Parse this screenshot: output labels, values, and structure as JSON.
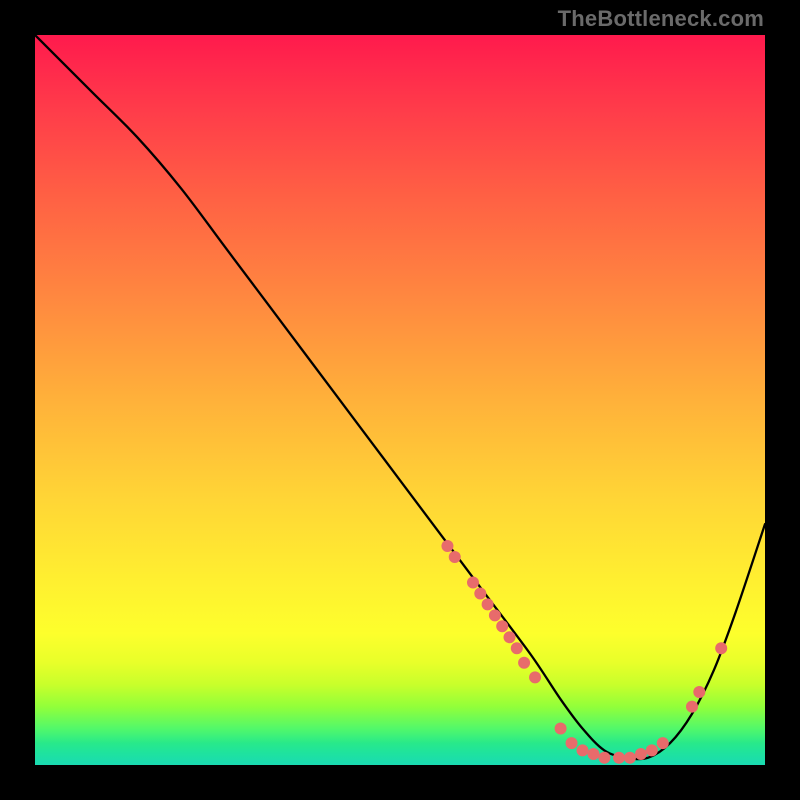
{
  "watermark": "TheBottleneck.com",
  "chart_data": {
    "type": "line",
    "title": "",
    "xlabel": "",
    "ylabel": "",
    "xlim": [
      0,
      100
    ],
    "ylim": [
      0,
      100
    ],
    "grid": false,
    "series": [
      {
        "name": "curve",
        "x": [
          0,
          3,
          8,
          14,
          20,
          26,
          32,
          38,
          44,
          50,
          56,
          62,
          68,
          72,
          75,
          78,
          81,
          84,
          87,
          90,
          93,
          96,
          100
        ],
        "y": [
          100,
          97,
          92,
          86,
          79,
          71,
          63,
          55,
          47,
          39,
          31,
          23,
          15,
          9,
          5,
          2,
          1,
          1,
          3,
          7,
          13,
          21,
          33
        ],
        "color": "#000000"
      }
    ],
    "markers": [
      {
        "x": 56.5,
        "y": 30
      },
      {
        "x": 57.5,
        "y": 28.5
      },
      {
        "x": 60,
        "y": 25
      },
      {
        "x": 61,
        "y": 23.5
      },
      {
        "x": 62,
        "y": 22
      },
      {
        "x": 63,
        "y": 20.5
      },
      {
        "x": 64,
        "y": 19
      },
      {
        "x": 65,
        "y": 17.5
      },
      {
        "x": 66,
        "y": 16
      },
      {
        "x": 67,
        "y": 14
      },
      {
        "x": 68.5,
        "y": 12
      },
      {
        "x": 72,
        "y": 5
      },
      {
        "x": 73.5,
        "y": 3
      },
      {
        "x": 75,
        "y": 2
      },
      {
        "x": 76.5,
        "y": 1.5
      },
      {
        "x": 78,
        "y": 1
      },
      {
        "x": 80,
        "y": 1
      },
      {
        "x": 81.5,
        "y": 1
      },
      {
        "x": 83,
        "y": 1.5
      },
      {
        "x": 84.5,
        "y": 2
      },
      {
        "x": 86,
        "y": 3
      },
      {
        "x": 90,
        "y": 8
      },
      {
        "x": 91,
        "y": 10
      },
      {
        "x": 94,
        "y": 16
      }
    ],
    "marker_color": "#e86b6b",
    "marker_radius": 6
  }
}
